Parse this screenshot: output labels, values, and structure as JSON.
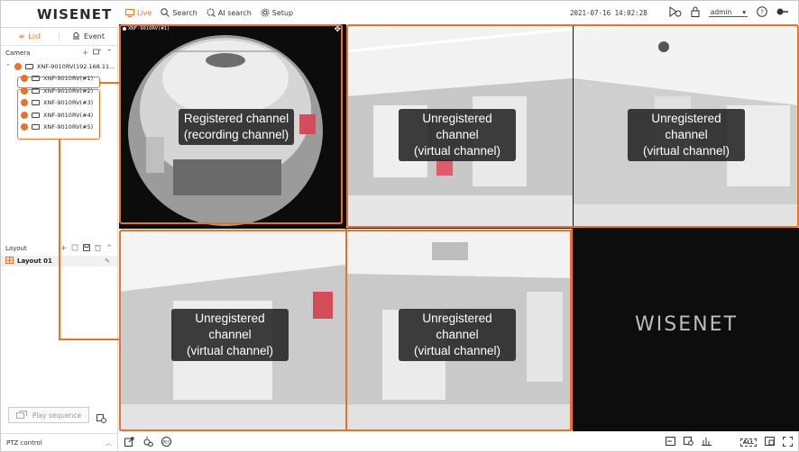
{
  "app": {
    "logo": "WISENET",
    "datetime": "2021-07-16 14:02:28",
    "user": "admin"
  },
  "nav": {
    "live": "Live",
    "search": "Search",
    "ai_search": "AI search",
    "setup": "Setup"
  },
  "sidebar": {
    "tabs": {
      "list": "List",
      "event": "Event"
    },
    "camera_header": "Camera",
    "device": "XNF-9010RV(192.168.11...",
    "channels": [
      "XNF-9010RV(#1)",
      "XNF-9010RV(#2)",
      "XNF-9010RV(#3)",
      "XNF-9010RV(#4)",
      "XNF-9010RV(#5)"
    ],
    "layout_header": "Layout",
    "layout_item": "Layout 01",
    "play_sequence": "Play sequence",
    "ptz_control": "PTZ control"
  },
  "tiles": [
    {
      "title": "XNF-9010RV(#1)",
      "label_line1": "Registered channel",
      "label_line2": "(recording channel)"
    },
    {
      "title": "XNF-9010RV(#2)",
      "label_line1": "Unregistered channel",
      "label_line2": "(virtual channel)"
    },
    {
      "title": "XNF-9010RV(#3)",
      "label_line1": "Unregistered channel",
      "label_line2": "(virtual channel)"
    },
    {
      "title": "XNF-9010RV(#4)",
      "label_line1": "Unregistered channel",
      "label_line2": "(virtual channel)"
    },
    {
      "title": "XNF-9010RV(#5)",
      "label_line1": "Unregistered channel",
      "label_line2": "(virtual channel)"
    }
  ],
  "empty_tile_brand": "WISENET",
  "bottom_bar": {
    "all_label": "ALL"
  },
  "colors": {
    "accent": "#e8722a",
    "tile_bg": "#101010"
  }
}
